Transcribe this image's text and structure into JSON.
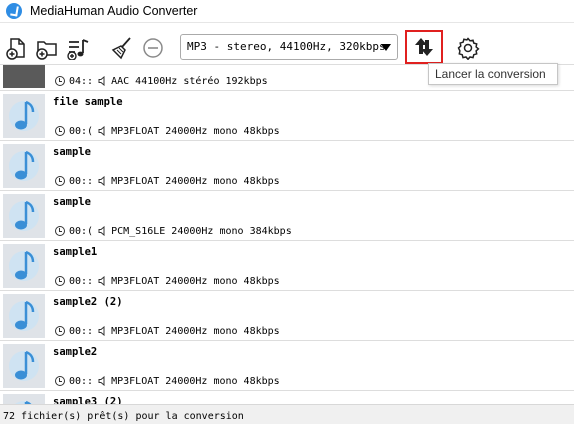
{
  "window": {
    "title": "MediaHuman Audio Converter"
  },
  "toolbar": {
    "format_selected": "MP3 - stereo, 44100Hz, 320kbps",
    "tooltip": "Lancer la conversion"
  },
  "files": [
    {
      "title": "",
      "duration": "04::",
      "info": "AAC 44100Hz stéréo 192kbps"
    },
    {
      "title": "file sample",
      "duration": "00:(",
      "info": "MP3FLOAT 24000Hz mono 48kbps"
    },
    {
      "title": "sample",
      "duration": "00::",
      "info": "MP3FLOAT 24000Hz mono 48kbps"
    },
    {
      "title": "sample",
      "duration": "00:(",
      "info": "PCM_S16LE 24000Hz mono 384kbps"
    },
    {
      "title": "sample1",
      "duration": "00::",
      "info": "MP3FLOAT 24000Hz mono 48kbps"
    },
    {
      "title": "sample2 (2)",
      "duration": "00::",
      "info": "MP3FLOAT 24000Hz mono 48kbps"
    },
    {
      "title": "sample2",
      "duration": "00::",
      "info": "MP3FLOAT 24000Hz mono 48kbps"
    },
    {
      "title": "sample3 (2)",
      "duration": "",
      "info": ""
    }
  ],
  "status": {
    "text": "72 fichier(s) prêt(s) pour la conversion"
  }
}
